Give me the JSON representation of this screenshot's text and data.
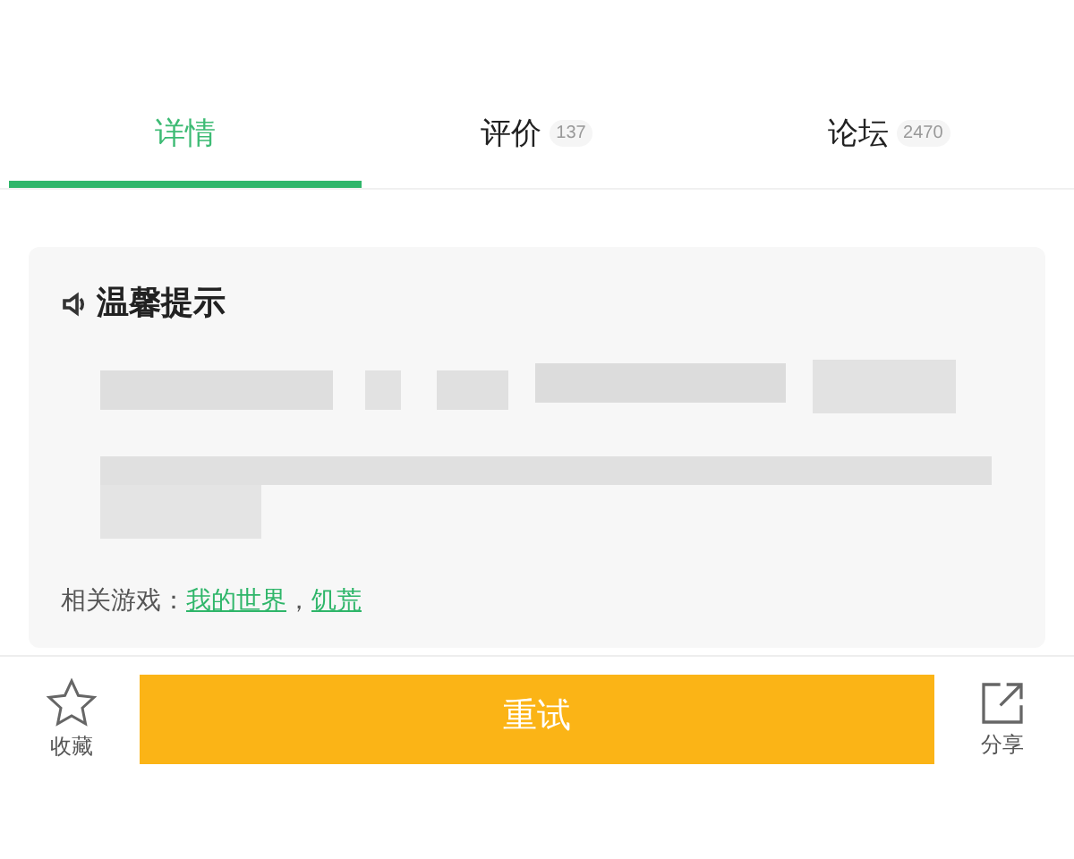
{
  "tabs": [
    {
      "label": "详情",
      "selected": true
    },
    {
      "label": "评价",
      "count": "137",
      "selected": false
    },
    {
      "label": "论坛",
      "count": "2470",
      "selected": false
    }
  ],
  "notice": {
    "title": "温馨提示",
    "related_label": "相关游戏：",
    "related_games": [
      "我的世界",
      "饥荒"
    ],
    "separator": "，"
  },
  "bottom_bar": {
    "favorite": "收藏",
    "retry": "重试",
    "share": "分享"
  }
}
